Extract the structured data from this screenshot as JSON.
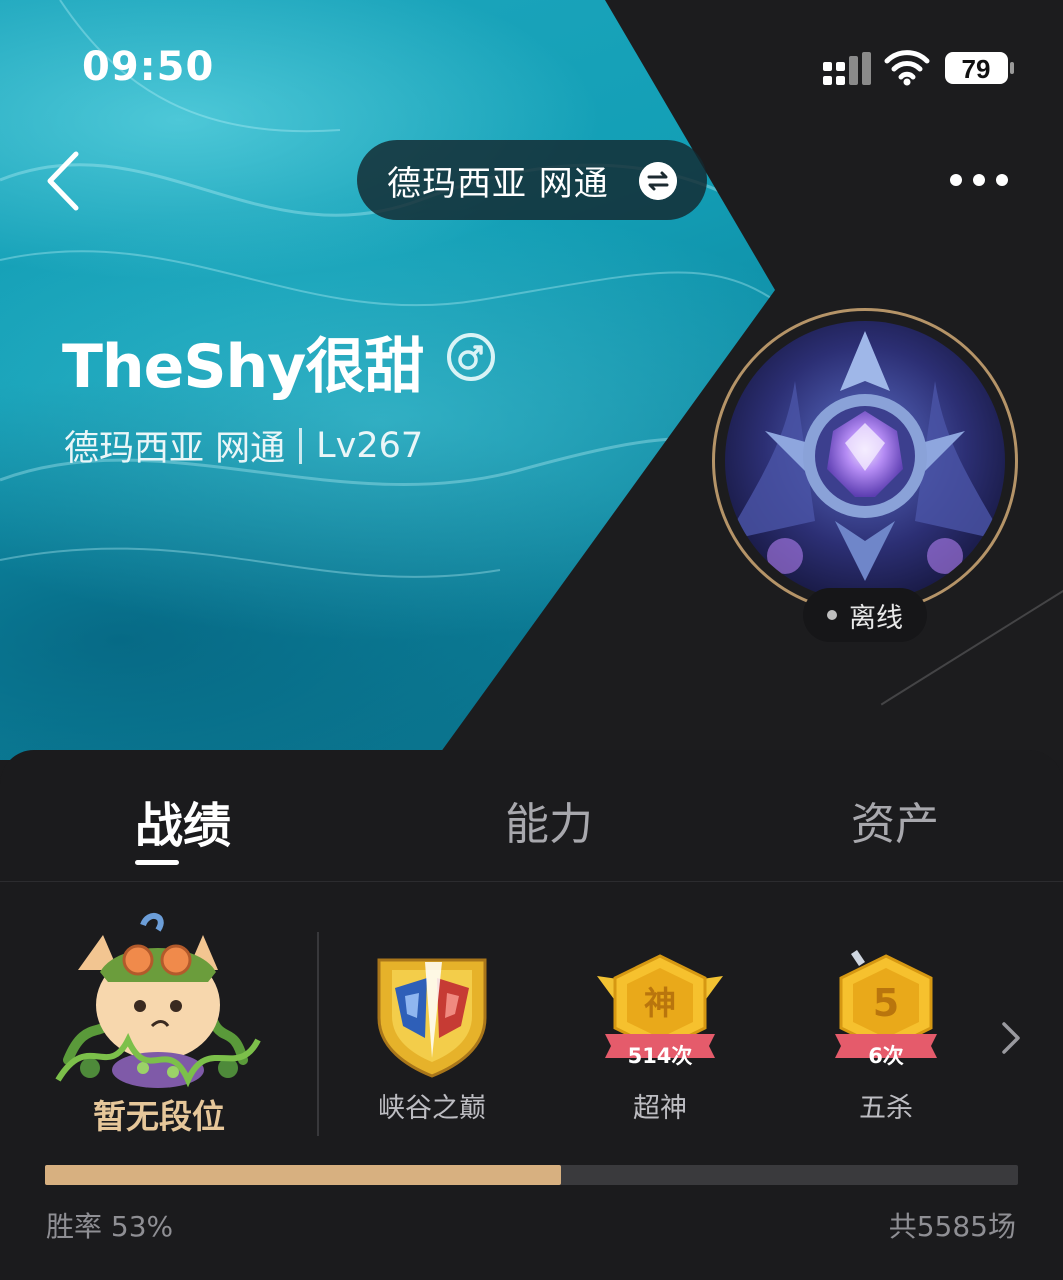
{
  "status_bar": {
    "time": "09:50",
    "battery": "79"
  },
  "header": {
    "server_pill": "德玛西亚 网通",
    "player_name": "TheShy很甜",
    "server": "德玛西亚 网通",
    "level": "Lv267",
    "online_status": "离线"
  },
  "tabs": [
    {
      "label": "战绩",
      "active": true
    },
    {
      "label": "能力",
      "active": false
    },
    {
      "label": "资产",
      "active": false
    }
  ],
  "rank": {
    "label": "暂无段位"
  },
  "honors": [
    {
      "name": "峡谷之巅",
      "count": ""
    },
    {
      "name": "超神",
      "count": "514次",
      "badge_char": "神"
    },
    {
      "name": "五杀",
      "count": "6次",
      "badge_char": "5"
    }
  ],
  "stats": {
    "win_rate_label": "胜率 53%",
    "win_rate": 0.53,
    "total_games": "共5585场"
  },
  "colors": {
    "accent_gold": "#d7b080",
    "teal": "#139fb6",
    "background": "#1b1b1d"
  }
}
